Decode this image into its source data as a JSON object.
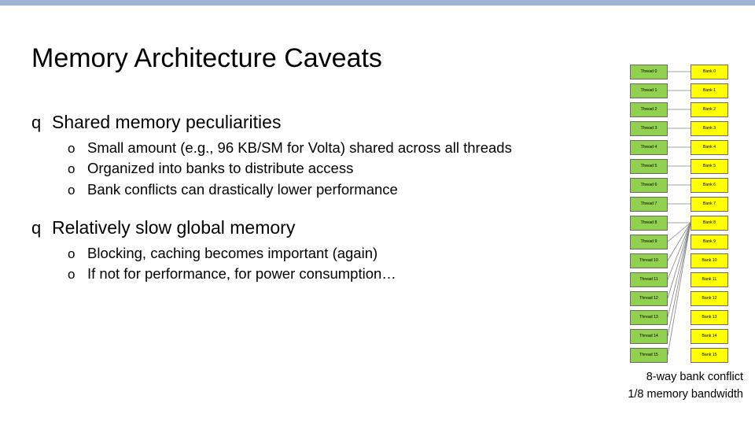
{
  "slide": {
    "title": "Memory Architecture Caveats",
    "bullets": [
      {
        "marker": "q",
        "text": "Shared memory peculiarities",
        "subs": [
          {
            "marker": "o",
            "text": "Small amount (e.g., 96 KB/SM for Volta) shared across all threads"
          },
          {
            "marker": "o",
            "text": "Organized into banks to distribute access"
          },
          {
            "marker": "o",
            "text": "Bank conflicts can drastically lower performance"
          }
        ]
      },
      {
        "marker": "q",
        "text": "Relatively slow global memory",
        "subs": [
          {
            "marker": "o",
            "text": "Blocking, caching becomes important (again)"
          },
          {
            "marker": "o",
            "text": "If not for performance, for power consumption…"
          }
        ]
      }
    ]
  },
  "diagram": {
    "thread_color": "#92d050",
    "bank_color": "#ffff00",
    "threads": [
      "Thread 0",
      "Thread 1",
      "Thread 2",
      "Thread 3",
      "Thread 4",
      "Thread 5",
      "Thread 6",
      "Thread 7",
      "Thread 8",
      "Thread 9",
      "Thread 10",
      "Thread 11",
      "Thread 12",
      "Thread 13",
      "Thread 14",
      "Thread 15"
    ],
    "banks": [
      "Bank 0",
      "Bank 1",
      "Bank 2",
      "Bank 3",
      "Bank 4",
      "Bank 5",
      "Bank 6",
      "Bank 7",
      "Bank 8",
      "Bank 9",
      "Bank 10",
      "Bank 11",
      "Bank 12",
      "Bank 13",
      "Bank 14",
      "Bank 15"
    ],
    "caption_line1": "8-way bank conflict",
    "caption_line2": "1/8 memory bandwidth"
  }
}
